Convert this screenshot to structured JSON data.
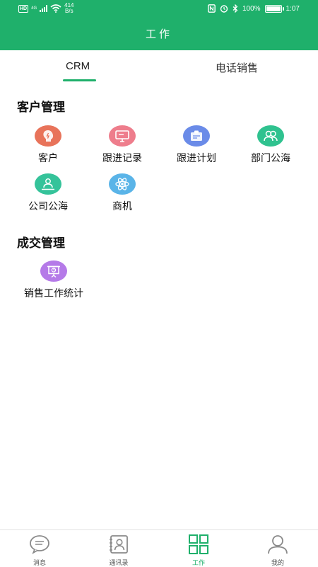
{
  "status_bar": {
    "hd": "HD",
    "network": "4G",
    "speed_value": "414",
    "speed_unit": "B/s",
    "battery": "100%",
    "time": "1:07"
  },
  "header": {
    "title": "工作"
  },
  "tabs": [
    {
      "label": "CRM",
      "active": true
    },
    {
      "label": "电话销售",
      "active": false
    }
  ],
  "sections": [
    {
      "title": "客户管理",
      "items": [
        {
          "label": "客户",
          "icon": "customer-head-icon",
          "color": "#e8735a"
        },
        {
          "label": "跟进记录",
          "icon": "monitor-record-icon",
          "color": "#ee7d8c"
        },
        {
          "label": "跟进计划",
          "icon": "clipboard-plan-icon",
          "color": "#6a8be8"
        },
        {
          "label": "部门公海",
          "icon": "group-people-icon",
          "color": "#2fc28f"
        },
        {
          "label": "公司公海",
          "icon": "person-company-icon",
          "color": "#35c39a"
        },
        {
          "label": "商机",
          "icon": "atom-opportunity-icon",
          "color": "#5ab4e8"
        }
      ]
    },
    {
      "title": "成交管理",
      "items": [
        {
          "label": "销售工作统计",
          "icon": "presentation-board-icon",
          "color": "#b57ae8"
        }
      ]
    }
  ],
  "tabbar": [
    {
      "label": "消息",
      "icon": "chat-bubble-icon",
      "active": false
    },
    {
      "label": "通讯录",
      "icon": "contacts-book-icon",
      "active": false
    },
    {
      "label": "工作",
      "icon": "grid-work-icon",
      "active": true
    },
    {
      "label": "我的",
      "icon": "person-profile-icon",
      "active": false
    }
  ],
  "colors": {
    "brand": "#1fb06b",
    "inactive_icon": "#888888"
  }
}
